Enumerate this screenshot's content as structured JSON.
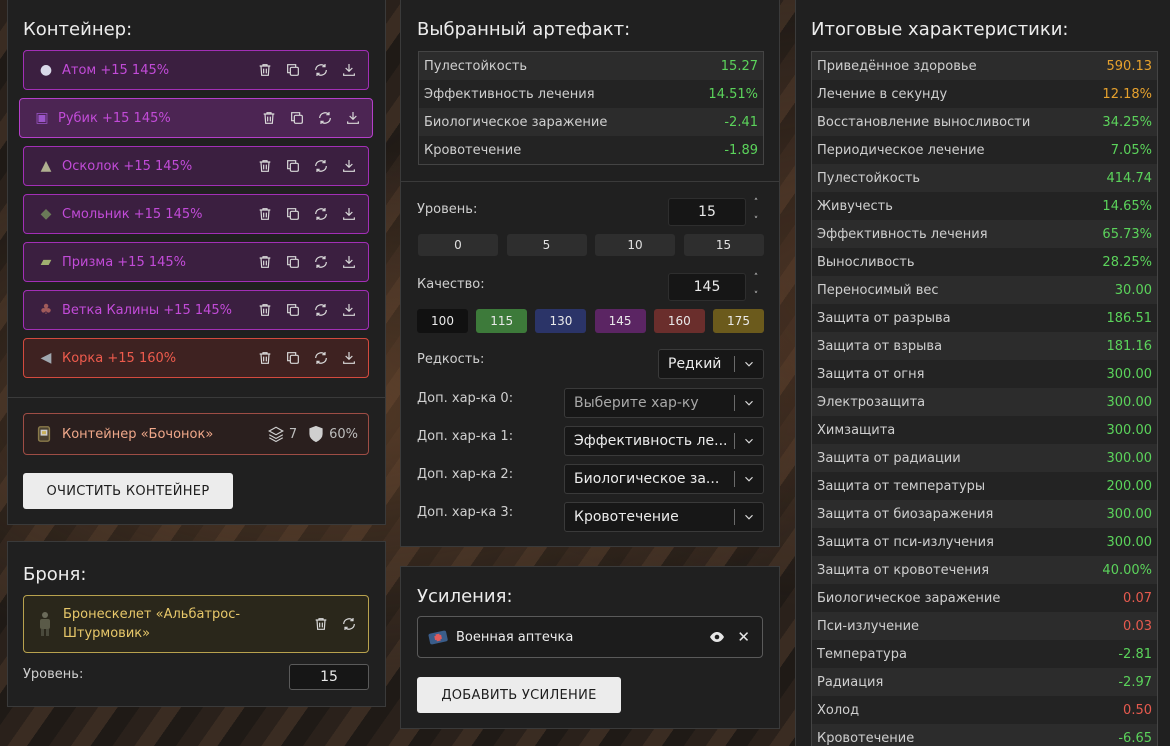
{
  "container": {
    "title": "Контейнер:",
    "items": [
      {
        "name": "Атом +15 145%",
        "icon": "atom-artifact-icon",
        "style": "purple"
      },
      {
        "name": "Рубик +15 145%",
        "icon": "rubik-artifact-icon",
        "style": "purple-selected"
      },
      {
        "name": "Осколок +15 145%",
        "icon": "shard-artifact-icon",
        "style": "purple"
      },
      {
        "name": "Смольник +15 145%",
        "icon": "resin-artifact-icon",
        "style": "purple"
      },
      {
        "name": "Призма +15 145%",
        "icon": "prism-artifact-icon",
        "style": "purple"
      },
      {
        "name": "Ветка Калины +15 145%",
        "icon": "viburnum-artifact-icon",
        "style": "purple"
      },
      {
        "name": "Корка +15 160%",
        "icon": "crust-artifact-icon",
        "style": "red"
      }
    ],
    "box": {
      "name": "Контейнер «Бочонок»",
      "slots": "7",
      "protection": "60%"
    },
    "clear_button": "ОЧИСТИТЬ КОНТЕЙНЕР"
  },
  "armor": {
    "title": "Броня:",
    "name": "Бронескелет «Альбатрос-Штурмовик»",
    "level_label": "Уровень:",
    "level_value": "15"
  },
  "artifact": {
    "title": "Выбранный артефакт:",
    "stats": [
      {
        "label": "Пулестойкость",
        "value": "15.27",
        "color": "green"
      },
      {
        "label": "Эффективность лечения",
        "value": "14.51%",
        "color": "green"
      },
      {
        "label": "Биологическое заражение",
        "value": "-2.41",
        "color": "green"
      },
      {
        "label": "Кровотечение",
        "value": "-1.89",
        "color": "green"
      }
    ],
    "level_label": "Уровень:",
    "level_value": "15",
    "level_presets": [
      "0",
      "5",
      "10",
      "15"
    ],
    "quality_label": "Качество:",
    "quality_value": "145",
    "quality_presets": [
      {
        "label": "100",
        "color": "#111111"
      },
      {
        "label": "115",
        "color": "#3d7a3a"
      },
      {
        "label": "130",
        "color": "#2b3468"
      },
      {
        "label": "145",
        "color": "#5b2563"
      },
      {
        "label": "160",
        "color": "#6a2e2c"
      },
      {
        "label": "175",
        "color": "#6b5a1c"
      }
    ],
    "rarity_label": "Редкость:",
    "rarity_value": "Редкий",
    "extra": [
      {
        "label": "Доп. хар-ка 0:",
        "value": "Выберите хар-ку",
        "placeholder": true
      },
      {
        "label": "Доп. хар-ка 1:",
        "value": "Эффективность ле...",
        "placeholder": false
      },
      {
        "label": "Доп. хар-ка 2:",
        "value": "Биологическое за...",
        "placeholder": false
      },
      {
        "label": "Доп. хар-ка 3:",
        "value": "Кровотечение",
        "placeholder": false
      }
    ]
  },
  "boosts": {
    "title": "Усиления:",
    "item": "Военная аптечка",
    "add_button": "ДОБАВИТЬ УСИЛЕНИЕ"
  },
  "totals": {
    "title": "Итоговые характеристики:",
    "stats": [
      {
        "label": "Приведённое здоровье",
        "value": "590.13",
        "color": "orange"
      },
      {
        "label": "Лечение в секунду",
        "value": "12.18%",
        "color": "orange"
      },
      {
        "label": "Восстановление выносливости",
        "value": "34.25%",
        "color": "green"
      },
      {
        "label": "Периодическое лечение",
        "value": "7.05%",
        "color": "green"
      },
      {
        "label": "Пулестойкость",
        "value": "414.74",
        "color": "green"
      },
      {
        "label": "Живучесть",
        "value": "14.65%",
        "color": "green"
      },
      {
        "label": "Эффективность лечения",
        "value": "65.73%",
        "color": "green"
      },
      {
        "label": "Выносливость",
        "value": "28.25%",
        "color": "green"
      },
      {
        "label": "Переносимый вес",
        "value": "30.00",
        "color": "green"
      },
      {
        "label": "Защита от разрыва",
        "value": "186.51",
        "color": "green"
      },
      {
        "label": "Защита от взрыва",
        "value": "181.16",
        "color": "green"
      },
      {
        "label": "Защита от огня",
        "value": "300.00",
        "color": "green"
      },
      {
        "label": "Электрозащита",
        "value": "300.00",
        "color": "green"
      },
      {
        "label": "Химзащита",
        "value": "300.00",
        "color": "green"
      },
      {
        "label": "Защита от радиации",
        "value": "300.00",
        "color": "green"
      },
      {
        "label": "Защита от температуры",
        "value": "200.00",
        "color": "green"
      },
      {
        "label": "Защита от биозаражения",
        "value": "300.00",
        "color": "green"
      },
      {
        "label": "Защита от пси-излучения",
        "value": "300.00",
        "color": "green"
      },
      {
        "label": "Защита от кровотечения",
        "value": "40.00%",
        "color": "green"
      },
      {
        "label": "Биологическое заражение",
        "value": "0.07",
        "color": "red"
      },
      {
        "label": "Пси-излучение",
        "value": "0.03",
        "color": "red"
      },
      {
        "label": "Температура",
        "value": "-2.81",
        "color": "green"
      },
      {
        "label": "Радиация",
        "value": "-2.97",
        "color": "green"
      },
      {
        "label": "Холод",
        "value": "0.50",
        "color": "red"
      },
      {
        "label": "Кровотечение",
        "value": "-6.65",
        "color": "green"
      }
    ]
  }
}
